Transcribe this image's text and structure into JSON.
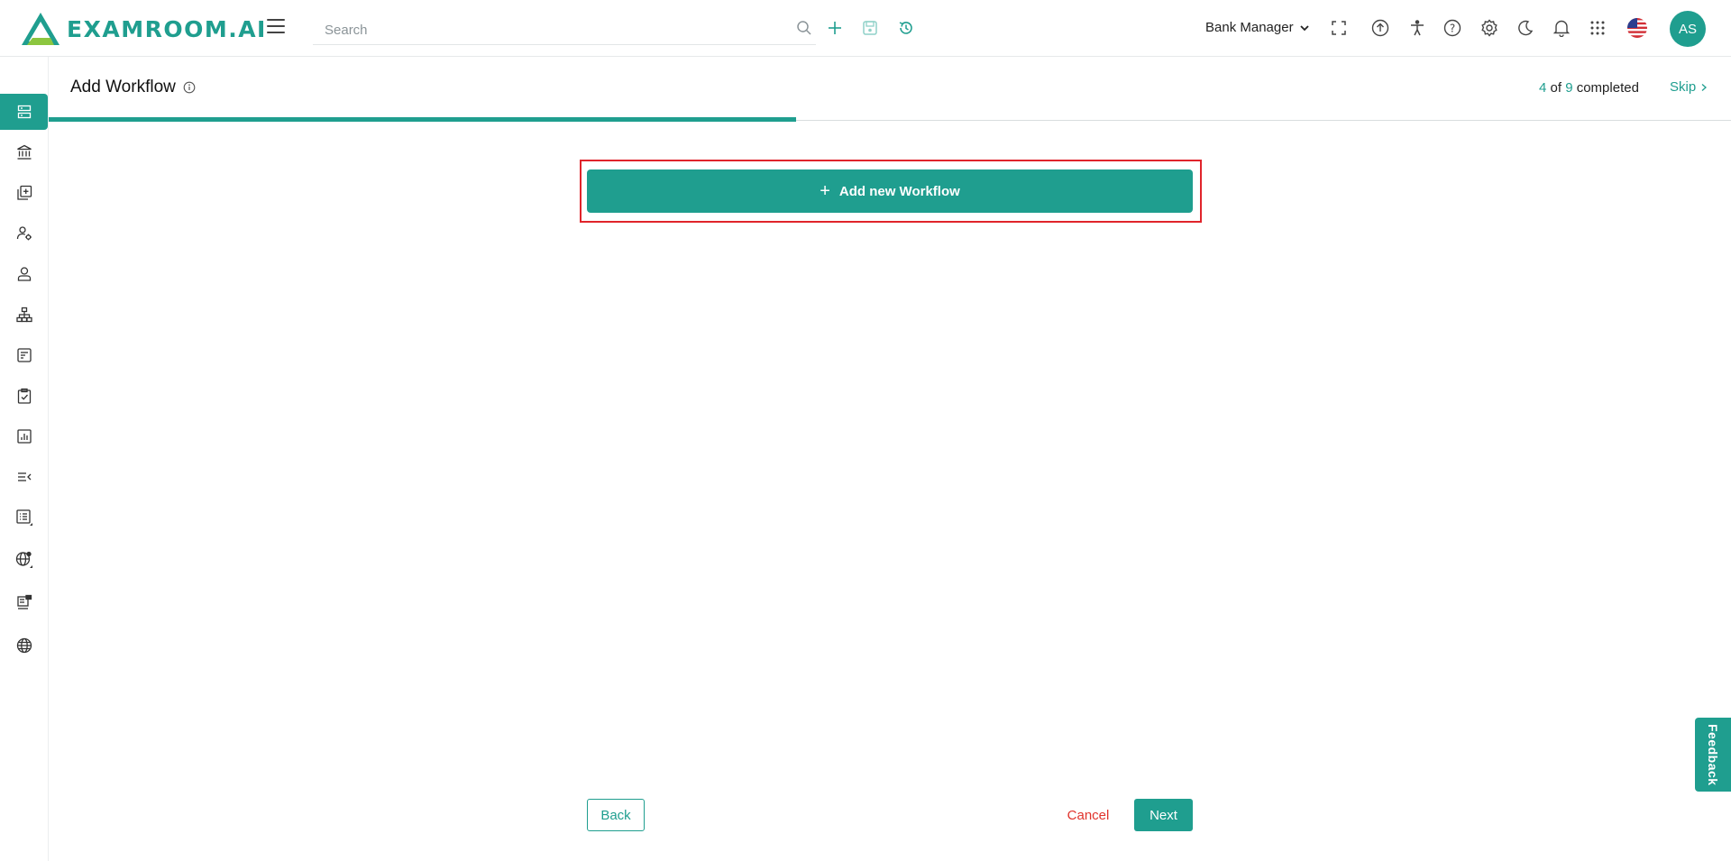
{
  "header": {
    "brand": "EXAMROOM.AI",
    "search_placeholder": "Search",
    "role": "Bank Manager",
    "avatar_initials": "AS"
  },
  "page": {
    "title": "Add Workflow",
    "progress": {
      "completed": "4",
      "of_label": "of",
      "total": "9",
      "completed_label": "completed",
      "fraction": 0.444
    },
    "skip_label": "Skip"
  },
  "main": {
    "add_button_label": "Add new Workflow"
  },
  "footer": {
    "back_label": "Back",
    "cancel_label": "Cancel",
    "next_label": "Next"
  },
  "feedback_label": "Feedback",
  "sidebar": {
    "items": [
      "workflow-icon",
      "bank-icon",
      "add-document-icon",
      "user-settings-icon",
      "user-icon",
      "hierarchy-icon",
      "form-icon",
      "clipboard-check-icon",
      "report-icon",
      "list-icon",
      "table-list-icon",
      "globe-settings-icon",
      "server-icon",
      "globe-icon"
    ]
  },
  "colors": {
    "accent": "#1f9e8f",
    "danger": "#e0332c",
    "highlight": "#e0242b"
  }
}
